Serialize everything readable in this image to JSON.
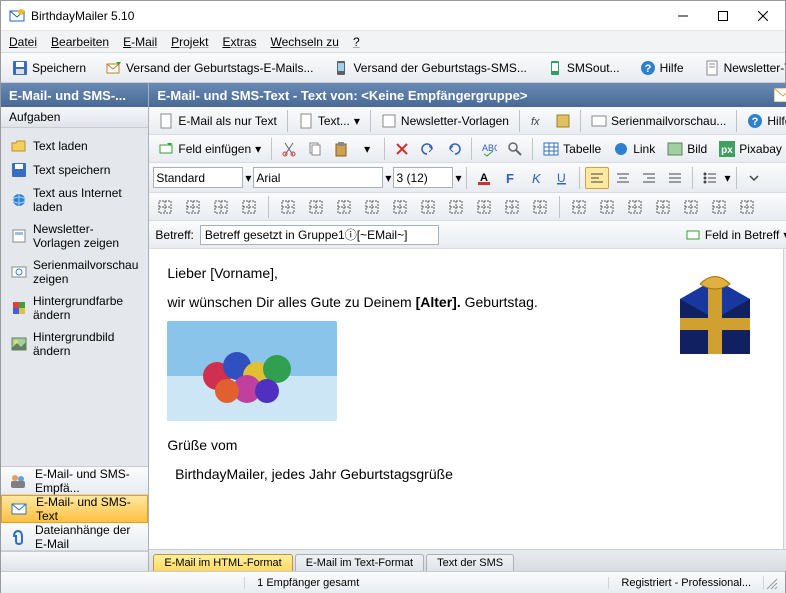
{
  "window": {
    "title": "BirthdayMailer 5.10"
  },
  "menu": {
    "items": [
      "Datei",
      "Bearbeiten",
      "E-Mail",
      "Projekt",
      "Extras",
      "Wechseln zu",
      "?"
    ]
  },
  "toolbar_main": {
    "save": "Speichern",
    "send_email": "Versand der Geburtstags-E-Mails...",
    "send_sms": "Versand der Geburtstags-SMS...",
    "smsout": "SMSout...",
    "help": "Hilfe",
    "newsletter": "Newsletter-Versand-Softw"
  },
  "sidebar": {
    "header": "E-Mail- und SMS-...",
    "sub": "Aufgaben",
    "items": [
      {
        "label": "Text laden",
        "icon": "open-icon"
      },
      {
        "label": "Text speichern",
        "icon": "save-icon"
      },
      {
        "label": "Text aus Internet laden",
        "icon": "globe-icon"
      },
      {
        "label": "Newsletter-Vorlagen zeigen",
        "icon": "template-icon"
      },
      {
        "label": "Serienmailvorschau zeigen",
        "icon": "preview-icon"
      },
      {
        "label": "Hintergrundfarbe ändern",
        "icon": "palette-icon"
      },
      {
        "label": "Hintergrundbild ändern",
        "icon": "image-icon"
      }
    ],
    "nav": [
      {
        "label": "E-Mail- und SMS-Empfä...",
        "icon": "users-icon",
        "active": false
      },
      {
        "label": "E-Mail- und SMS-Text",
        "icon": "mailtext-icon",
        "active": true
      },
      {
        "label": "Dateianhänge der E-Mail",
        "icon": "attach-icon",
        "active": false
      }
    ]
  },
  "main": {
    "header": "E-Mail- und SMS-Text - Text von: <Keine Empfängergruppe>"
  },
  "toolbar2": {
    "textonly": "E-Mail als nur Text",
    "text": "Text...",
    "templates": "Newsletter-Vorlagen",
    "preview": "Serienmailvorschau...",
    "help": "Hilfe"
  },
  "toolbar3": {
    "insertfield": "Feld einfügen",
    "table": "Tabelle",
    "link": "Link",
    "image": "Bild",
    "pixabay": "Pixabay"
  },
  "toolbar4": {
    "style": "Standard",
    "font": "Arial",
    "size": "3 (12)"
  },
  "subject": {
    "label": "Betreff:",
    "value": "Betreff gesetzt in Gruppe1ⓘ[~EMail~]",
    "fieldbtn": "Feld in Betreff"
  },
  "editor": {
    "line1": "Lieber [Vorname],",
    "line2a": "wir wünschen Dir alles Gute zu Deinem ",
    "line2b": "[Alter].",
    "line2c": " Geburtstag.",
    "line3": "Grüße vom",
    "line4": "  BirthdayMailer, jedes Jahr Geburtstagsgrüße"
  },
  "tabs": {
    "items": [
      {
        "label": "E-Mail im HTML-Format",
        "active": true
      },
      {
        "label": "E-Mail im Text-Format",
        "active": false
      },
      {
        "label": "Text der SMS",
        "active": false
      }
    ]
  },
  "status": {
    "recipients": "1 Empfänger gesamt",
    "license": "Registriert - Professional..."
  }
}
